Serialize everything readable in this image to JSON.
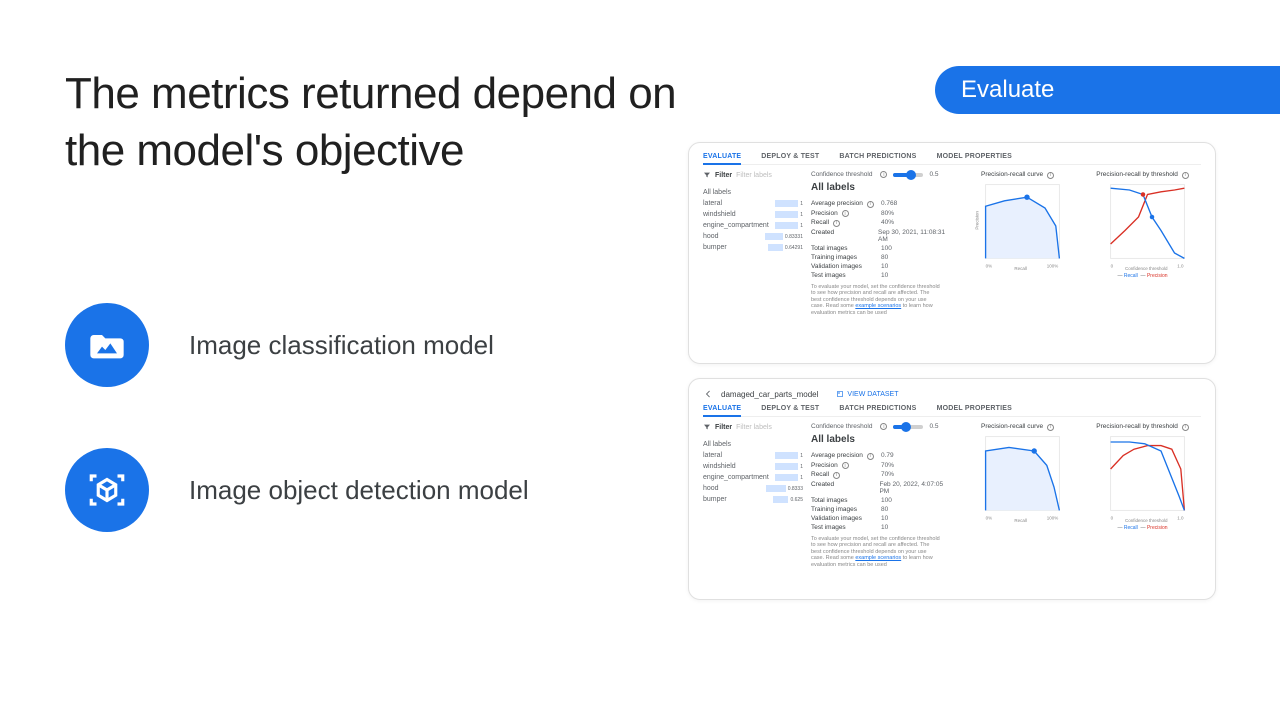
{
  "pill_label": "Evaluate",
  "title": "The metrics returned depend on the model's objective",
  "items": [
    {
      "label": "Image classification model"
    },
    {
      "label": "Image object detection model"
    }
  ],
  "tabs": [
    "EVALUATE",
    "DEPLOY & TEST",
    "BATCH PREDICTIONS",
    "MODEL PROPERTIES"
  ],
  "filter_label": "Filter",
  "filter_placeholder": "Filter labels",
  "conf_label": "Confidence threshold",
  "all_labels_heading": "All labels",
  "help_info_icon": "i",
  "charts": {
    "pr_curve": "Precision-recall curve",
    "pr_thresh": "Precision-recall by threshold"
  },
  "axis": {
    "precision": "Precision",
    "recall": "Recall",
    "ct": "Confidence threshold",
    "zero": "0%",
    "hundred": "100%",
    "zeroN": "0",
    "one": "1.0"
  },
  "legend": {
    "recall": "Recall",
    "precision": "Precision"
  },
  "shot1": {
    "conf_value": "0.5",
    "labels": [
      {
        "name": "All labels",
        "bar": 0,
        "val": ""
      },
      {
        "name": "lateral",
        "bar": 62,
        "val": "1"
      },
      {
        "name": "windshield",
        "bar": 62,
        "val": "1"
      },
      {
        "name": "engine_compartment",
        "bar": 62,
        "val": "1"
      },
      {
        "name": "hood",
        "bar": 52,
        "val": "0.83331"
      },
      {
        "name": "bumper",
        "bar": 40,
        "val": "0.64291"
      }
    ],
    "metrics": [
      {
        "k": "Average precision",
        "v": "0.768",
        "info": true
      },
      {
        "k": "Precision",
        "v": "80%",
        "info": true
      },
      {
        "k": "Recall",
        "v": "40%",
        "info": true
      },
      {
        "k": "Created",
        "v": "Sep 30, 2021, 11:08:31 AM"
      },
      {
        "k": "Total images",
        "v": "100"
      },
      {
        "k": "Training images",
        "v": "80"
      },
      {
        "k": "Validation images",
        "v": "10"
      },
      {
        "k": "Test images",
        "v": "10"
      }
    ],
    "note_pre": "To evaluate your model, set the confidence threshold to see how precision and recall are affected. The best confidence threshold depends on your use case. Read some ",
    "note_link": "example scenarios",
    "note_post": " to learn how evaluation metrics can be used"
  },
  "shot2": {
    "model_name": "damaged_car_parts_model",
    "view_dataset": "VIEW DATASET",
    "conf_value": "0.5",
    "labels": [
      {
        "name": "All labels",
        "bar": 0,
        "val": ""
      },
      {
        "name": "lateral",
        "bar": 62,
        "val": "1"
      },
      {
        "name": "windshield",
        "bar": 62,
        "val": "1"
      },
      {
        "name": "engine_compartment",
        "bar": 62,
        "val": "1"
      },
      {
        "name": "hood",
        "bar": 52,
        "val": "0.8333"
      },
      {
        "name": "bumper",
        "bar": 40,
        "val": "0.625"
      }
    ],
    "metrics": [
      {
        "k": "Average precision",
        "v": "0.79",
        "info": true
      },
      {
        "k": "Precision",
        "v": "70%",
        "info": true
      },
      {
        "k": "Recall",
        "v": "70%",
        "info": true
      },
      {
        "k": "Created",
        "v": "Feb 20, 2022, 4:07:05 PM"
      },
      {
        "k": "Total images",
        "v": "100"
      },
      {
        "k": "Training images",
        "v": "80"
      },
      {
        "k": "Validation images",
        "v": "10"
      },
      {
        "k": "Test images",
        "v": "10"
      }
    ],
    "note_pre": "To evaluate your model, set the confidence threshold to see how precision and recall are affected. The best confidence threshold depends on your use case. Read some ",
    "note_link": "example scenarios",
    "note_post": " to learn how evaluation metrics can be used"
  }
}
